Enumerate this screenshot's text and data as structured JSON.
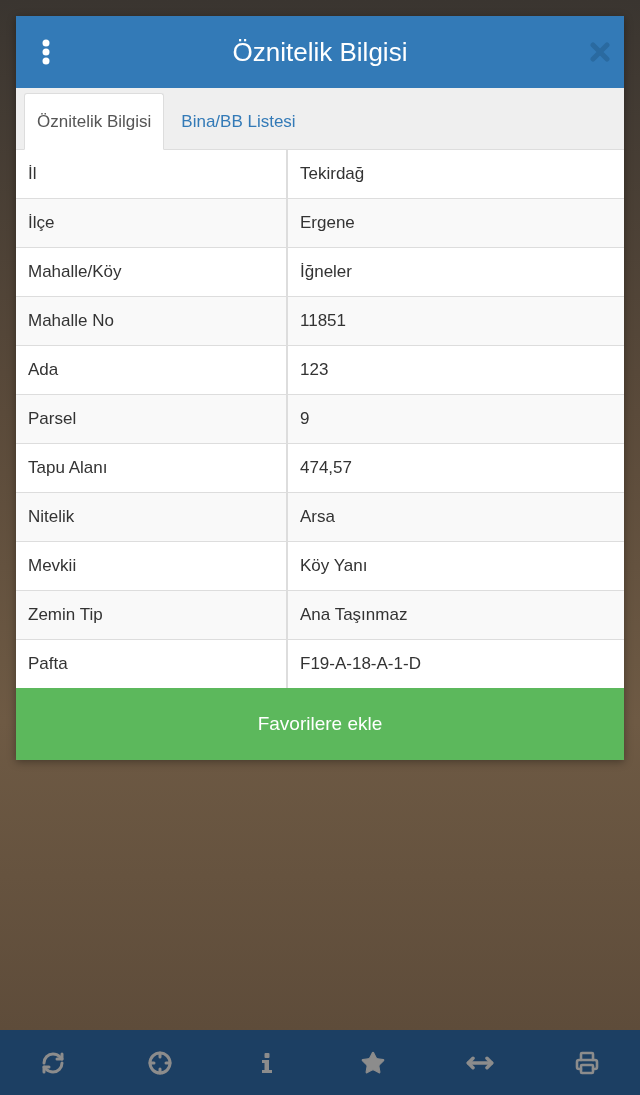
{
  "dialog": {
    "title": "Öznitelik Bilgisi"
  },
  "tabs": [
    {
      "label": "Öznitelik Bilgisi",
      "selected": true
    },
    {
      "label": "Bina/BB Listesi",
      "selected": false
    }
  ],
  "attributes": [
    {
      "name": "İl",
      "value": "Tekirdağ"
    },
    {
      "name": "İlçe",
      "value": "Ergene"
    },
    {
      "name": "Mahalle/Köy",
      "value": "İğneler"
    },
    {
      "name": "Mahalle No",
      "value": "11851"
    },
    {
      "name": "Ada",
      "value": "123"
    },
    {
      "name": "Parsel",
      "value": "9"
    },
    {
      "name": "Tapu Alanı",
      "value": "474,57"
    },
    {
      "name": "Nitelik",
      "value": "Arsa"
    },
    {
      "name": "Mevkii",
      "value": "Köy Yanı"
    },
    {
      "name": "Zemin Tip",
      "value": "Ana Taşınmaz"
    },
    {
      "name": "Pafta",
      "value": "F19-A-18-A-1-D"
    }
  ],
  "favorite_button": {
    "label": "Favorilere ekle"
  }
}
